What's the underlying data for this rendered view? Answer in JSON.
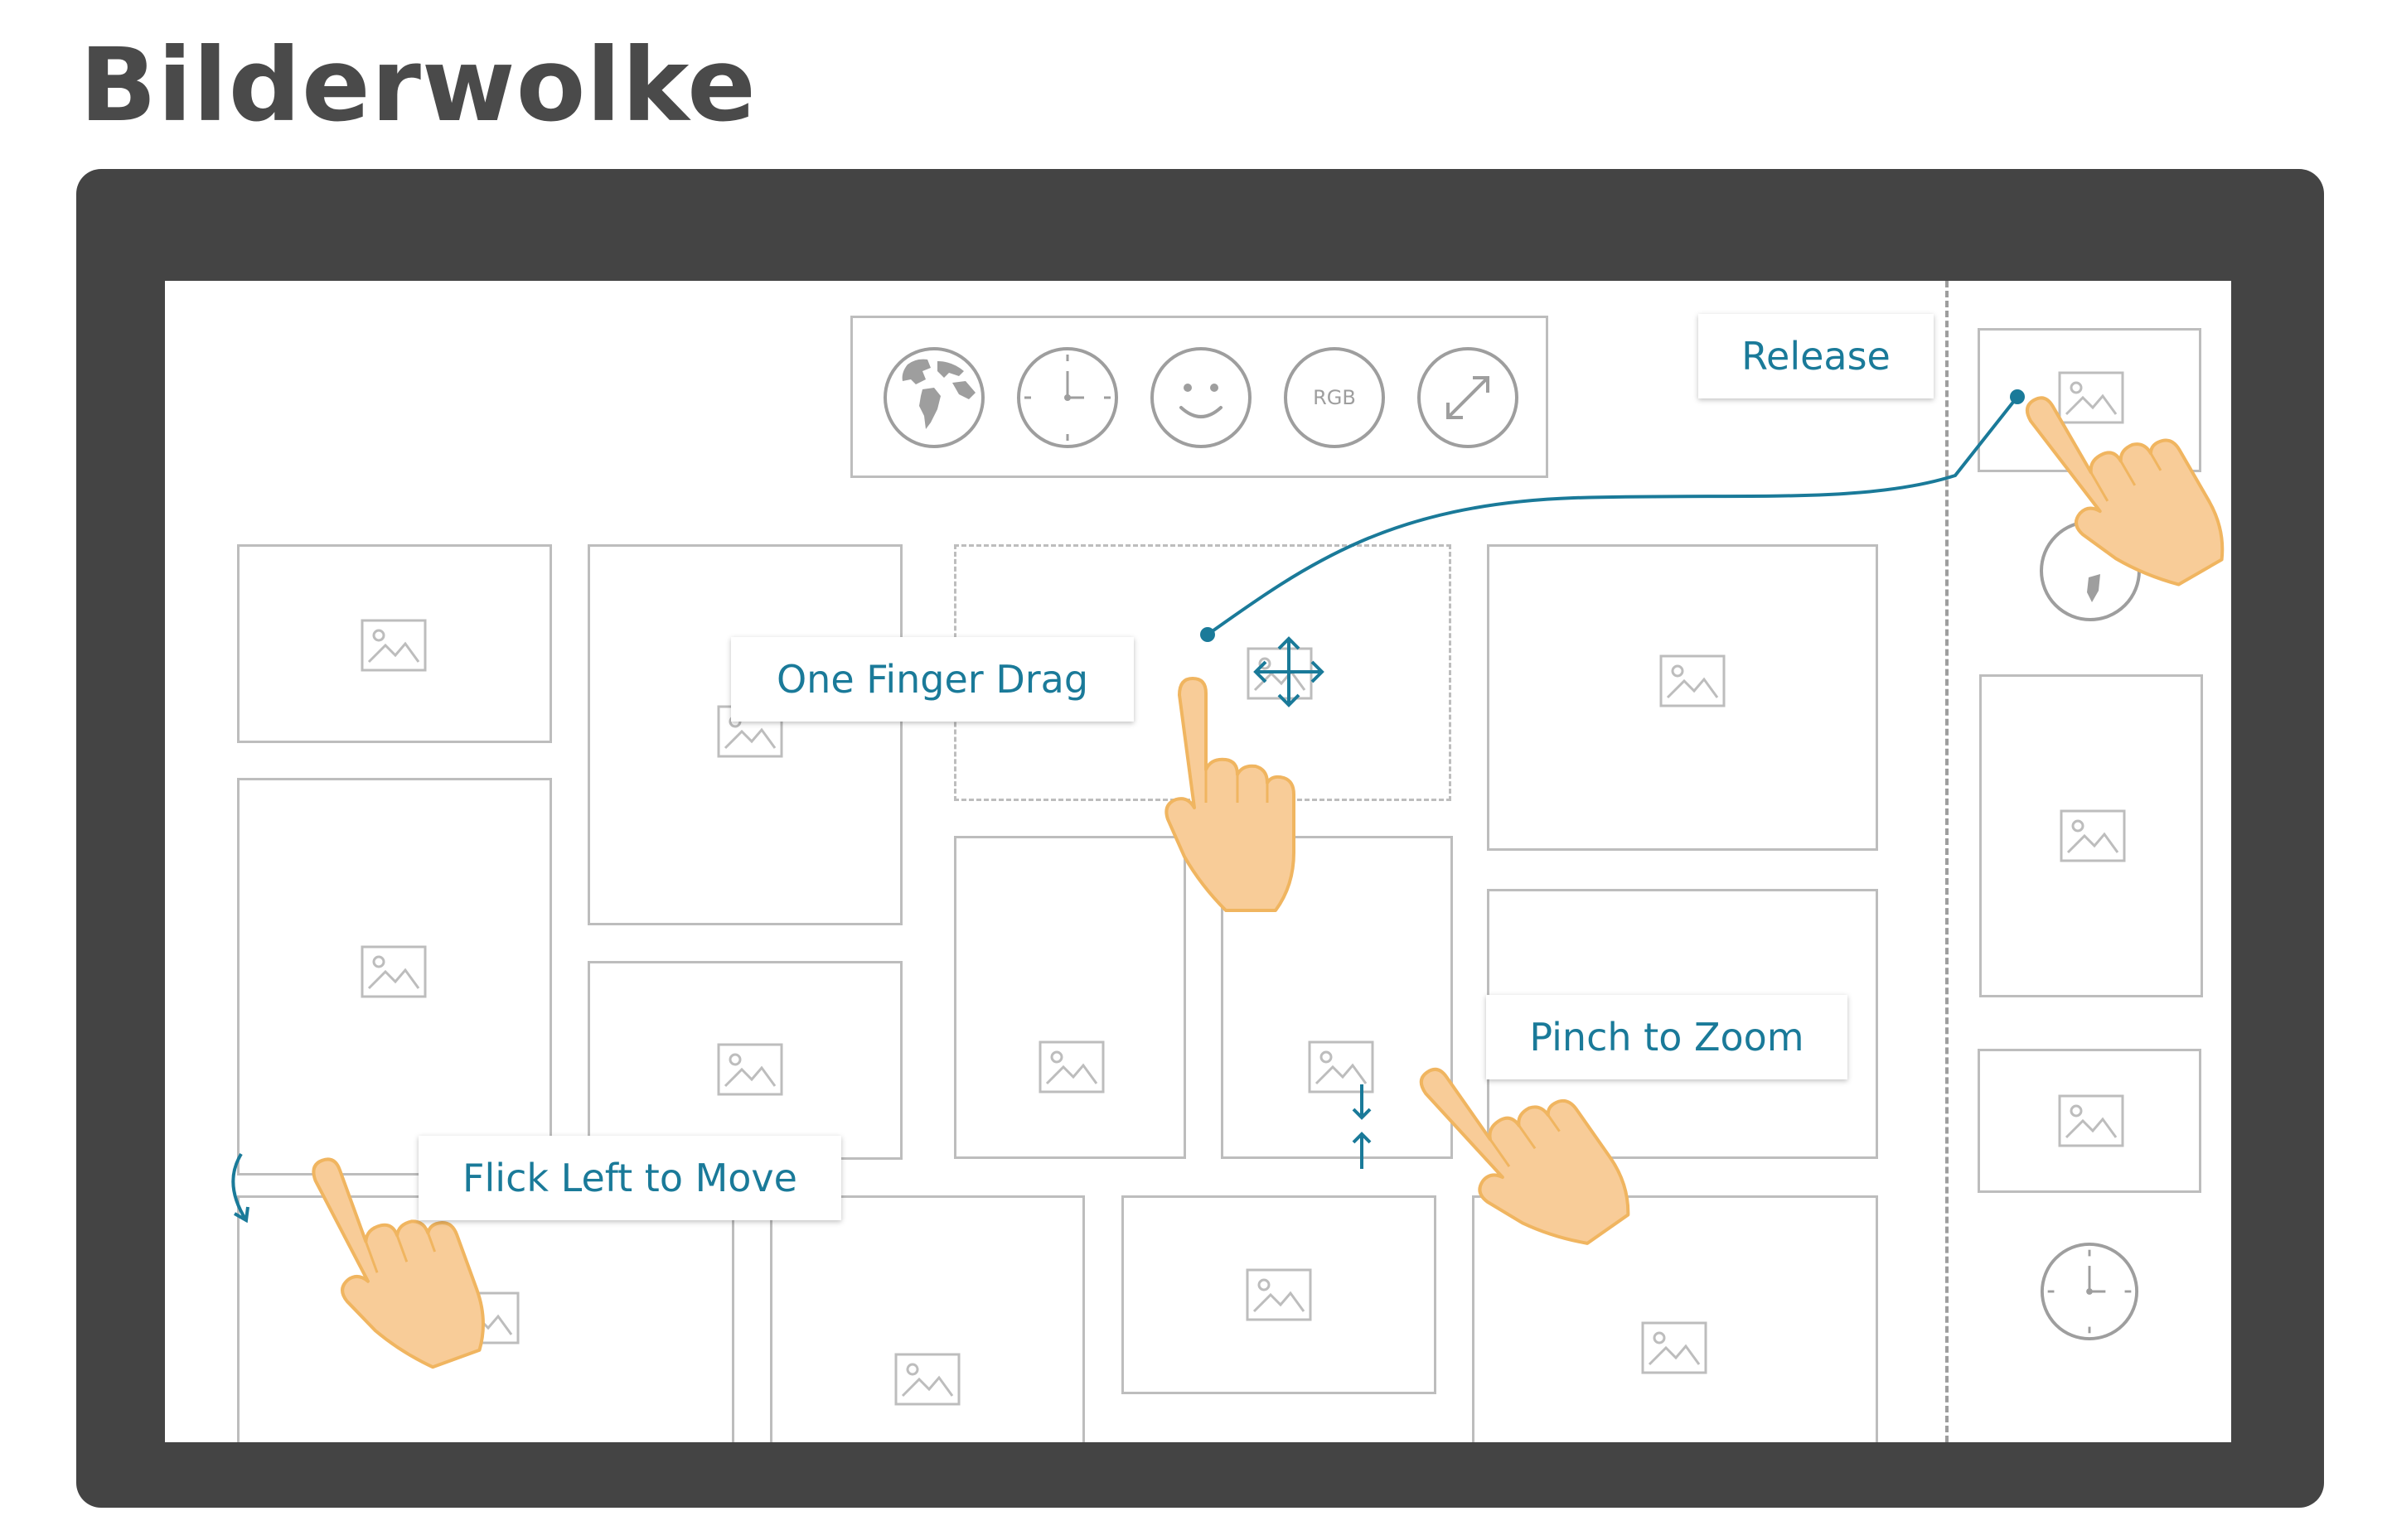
{
  "page": {
    "title": "Bilderwolke"
  },
  "toolbar": {
    "buttons": [
      {
        "name": "globe-button",
        "icon": "globe-icon"
      },
      {
        "name": "clock-button",
        "icon": "clock-icon"
      },
      {
        "name": "smiley-button",
        "icon": "smiley-icon"
      },
      {
        "name": "rgb-button",
        "icon": "rgb-icon",
        "text": "RGB"
      },
      {
        "name": "expand-button",
        "icon": "expand-arrows-icon"
      }
    ]
  },
  "gestures": {
    "release": "Release",
    "one_finger_drag": "One Finger Drag",
    "pinch_to_zoom": "Pinch to Zoom",
    "flick_left": "Flick Left to Move"
  },
  "colors": {
    "frame": "#444444",
    "accent": "#1a7a99",
    "tile_border": "#bdbdbd",
    "hand_fill": "#f8cc98",
    "hand_stroke": "#f0b560"
  }
}
